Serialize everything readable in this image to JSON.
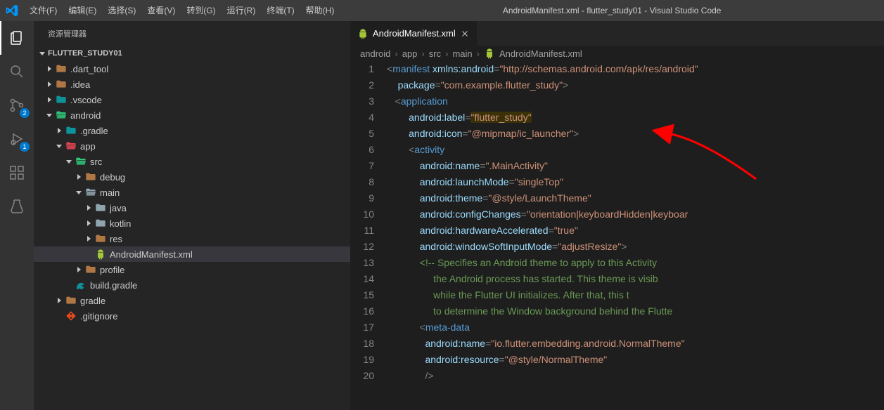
{
  "title": "AndroidManifest.xml - flutter_study01 - Visual Studio Code",
  "menus": [
    "文件(F)",
    "编辑(E)",
    "选择(S)",
    "查看(V)",
    "转到(G)",
    "运行(R)",
    "终端(T)",
    "帮助(H)"
  ],
  "sidebar": {
    "header": "资源管理器",
    "section": "FLUTTER_STUDY01",
    "tree": [
      {
        "d": 1,
        "exp": false,
        "icon": "folder-closed",
        "color": "#b07745",
        "label": ".dart_tool"
      },
      {
        "d": 1,
        "exp": false,
        "icon": "folder-closed",
        "color": "#b07745",
        "label": ".idea"
      },
      {
        "d": 1,
        "exp": false,
        "icon": "folder-closed",
        "color": "#0d929a",
        "label": ".vscode"
      },
      {
        "d": 1,
        "exp": true,
        "icon": "folder-open",
        "color": "#30c97a",
        "label": "android"
      },
      {
        "d": 2,
        "exp": false,
        "icon": "folder-closed",
        "color": "#0d929a",
        "label": ".gradle"
      },
      {
        "d": 2,
        "exp": true,
        "icon": "folder-open",
        "color": "#e64553",
        "label": "app"
      },
      {
        "d": 3,
        "exp": true,
        "icon": "folder-open",
        "color": "#30c97a",
        "label": "src"
      },
      {
        "d": 4,
        "exp": false,
        "icon": "folder-closed",
        "color": "#b07745",
        "label": "debug"
      },
      {
        "d": 4,
        "exp": true,
        "icon": "folder-open",
        "color": "#90a4ae",
        "label": "main"
      },
      {
        "d": 5,
        "exp": false,
        "icon": "folder-closed",
        "color": "#90a4ae",
        "label": "java"
      },
      {
        "d": 5,
        "exp": false,
        "icon": "folder-closed",
        "color": "#90a4ae",
        "label": "kotlin"
      },
      {
        "d": 5,
        "exp": false,
        "icon": "folder-closed",
        "color": "#b07745",
        "label": "res"
      },
      {
        "d": 5,
        "exp": null,
        "icon": "android",
        "color": "#a4c639",
        "label": "AndroidManifest.xml",
        "selected": true
      },
      {
        "d": 4,
        "exp": false,
        "icon": "folder-closed",
        "color": "#b07745",
        "label": "profile"
      },
      {
        "d": 3,
        "exp": null,
        "icon": "gradle",
        "color": "#0d929a",
        "label": "build.gradle"
      },
      {
        "d": 2,
        "exp": false,
        "icon": "folder-closed",
        "color": "#b07745",
        "label": "gradle"
      },
      {
        "d": 2,
        "exp": null,
        "icon": "git",
        "color": "#e64a19",
        "label": ".gitignore"
      }
    ]
  },
  "activity": {
    "scm_badge": "2",
    "debug_badge": "1"
  },
  "tab": {
    "label": "AndroidManifest.xml"
  },
  "breadcrumbs": [
    "android",
    "app",
    "src",
    "main",
    "AndroidManifest.xml"
  ],
  "code": {
    "lines": [
      {
        "n": 1,
        "seg": [
          [
            "p",
            "<"
          ],
          [
            "t",
            "manifest"
          ],
          [
            "p",
            " "
          ],
          [
            "a",
            "xmlns:android"
          ],
          [
            "p",
            "="
          ],
          [
            "s",
            "\"http://schemas.android.com/apk/res/android\""
          ]
        ]
      },
      {
        "n": 2,
        "seg": [
          [
            "p",
            "    "
          ],
          [
            "a",
            "package"
          ],
          [
            "p",
            "="
          ],
          [
            "s",
            "\"com.example.flutter_study\""
          ],
          [
            "p",
            ">"
          ]
        ]
      },
      {
        "n": 3,
        "seg": [
          [
            "p",
            "   <"
          ],
          [
            "t",
            "application"
          ]
        ]
      },
      {
        "n": 4,
        "seg": [
          [
            "p",
            "        "
          ],
          [
            "a",
            "android:label"
          ],
          [
            "p",
            "="
          ],
          [
            "s-hl",
            "\"flutter_study\""
          ]
        ]
      },
      {
        "n": 5,
        "seg": [
          [
            "p",
            "        "
          ],
          [
            "a",
            "android:icon"
          ],
          [
            "p",
            "="
          ],
          [
            "s",
            "\"@mipmap/ic_launcher\""
          ],
          [
            "p",
            ">"
          ]
        ]
      },
      {
        "n": 6,
        "seg": [
          [
            "p",
            "        <"
          ],
          [
            "t",
            "activity"
          ]
        ]
      },
      {
        "n": 7,
        "seg": [
          [
            "p",
            "            "
          ],
          [
            "a",
            "android:name"
          ],
          [
            "p",
            "="
          ],
          [
            "s",
            "\".MainActivity\""
          ]
        ]
      },
      {
        "n": 8,
        "seg": [
          [
            "p",
            "            "
          ],
          [
            "a",
            "android:launchMode"
          ],
          [
            "p",
            "="
          ],
          [
            "s",
            "\"singleTop\""
          ]
        ]
      },
      {
        "n": 9,
        "seg": [
          [
            "p",
            "            "
          ],
          [
            "a",
            "android:theme"
          ],
          [
            "p",
            "="
          ],
          [
            "s",
            "\"@style/LaunchTheme\""
          ]
        ]
      },
      {
        "n": 10,
        "seg": [
          [
            "p",
            "            "
          ],
          [
            "a",
            "android:configChanges"
          ],
          [
            "p",
            "="
          ],
          [
            "s",
            "\"orientation|keyboardHidden|keyboar"
          ]
        ]
      },
      {
        "n": 11,
        "seg": [
          [
            "p",
            "            "
          ],
          [
            "a",
            "android:hardwareAccelerated"
          ],
          [
            "p",
            "="
          ],
          [
            "s",
            "\"true\""
          ]
        ]
      },
      {
        "n": 12,
        "seg": [
          [
            "p",
            "            "
          ],
          [
            "a",
            "android:windowSoftInputMode"
          ],
          [
            "p",
            "="
          ],
          [
            "s",
            "\"adjustResize\""
          ],
          [
            "p",
            ">"
          ]
        ]
      },
      {
        "n": 13,
        "seg": [
          [
            "c",
            "            <!-- Specifies an Android theme to apply to this Activity"
          ]
        ]
      },
      {
        "n": 14,
        "seg": [
          [
            "c",
            "                 the Android process has started. This theme is visib"
          ]
        ]
      },
      {
        "n": 15,
        "seg": [
          [
            "c",
            "                 while the Flutter UI initializes. After that, this t"
          ]
        ]
      },
      {
        "n": 16,
        "seg": [
          [
            "c",
            "                 to determine the Window background behind the Flutte"
          ]
        ]
      },
      {
        "n": 17,
        "seg": [
          [
            "p",
            "            <"
          ],
          [
            "t",
            "meta-data"
          ]
        ]
      },
      {
        "n": 18,
        "seg": [
          [
            "p",
            "              "
          ],
          [
            "a",
            "android:name"
          ],
          [
            "p",
            "="
          ],
          [
            "s",
            "\"io.flutter.embedding.android.NormalTheme\""
          ]
        ]
      },
      {
        "n": 19,
        "seg": [
          [
            "p",
            "              "
          ],
          [
            "a",
            "android:resource"
          ],
          [
            "p",
            "="
          ],
          [
            "s",
            "\"@style/NormalTheme\""
          ]
        ]
      },
      {
        "n": 20,
        "seg": [
          [
            "p",
            "              />"
          ]
        ]
      }
    ]
  }
}
